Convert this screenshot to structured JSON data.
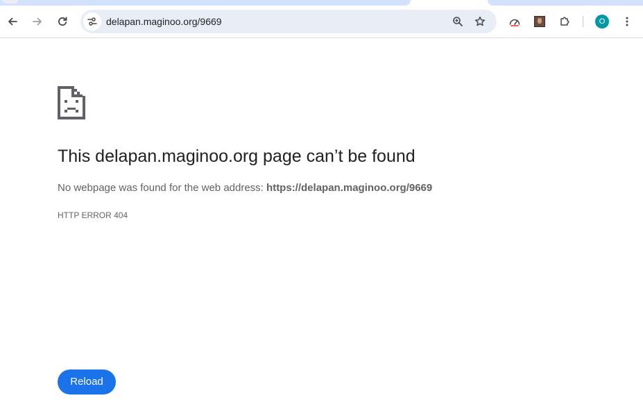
{
  "browser": {
    "url": "delapan.maginoo.org/9669",
    "profile_initial": "O",
    "icons": {
      "back": "back-arrow-icon",
      "forward": "forward-arrow-icon",
      "reload": "reload-icon",
      "site_info": "tune-icon",
      "zoom": "zoom-icon",
      "bookmark": "star-icon",
      "extension_1": "gauge-icon",
      "extension_2": "picture-icon",
      "extensions": "puzzle-icon",
      "menu": "more-vert-icon"
    },
    "colors": {
      "tab_active": "#d3e3fd",
      "omnibox_bg": "#e9eef6",
      "avatar_bg": "#0097a7"
    }
  },
  "error_page": {
    "icon": "sad-page-icon",
    "headline": "This delapan.maginoo.org page can’t be found",
    "description_prefix": "No webpage was found for the web address: ",
    "description_url": "https://delapan.maginoo.org/9669",
    "error_code": "HTTP ERROR 404",
    "reload_label": "Reload",
    "reload_color": "#1a73e8"
  }
}
